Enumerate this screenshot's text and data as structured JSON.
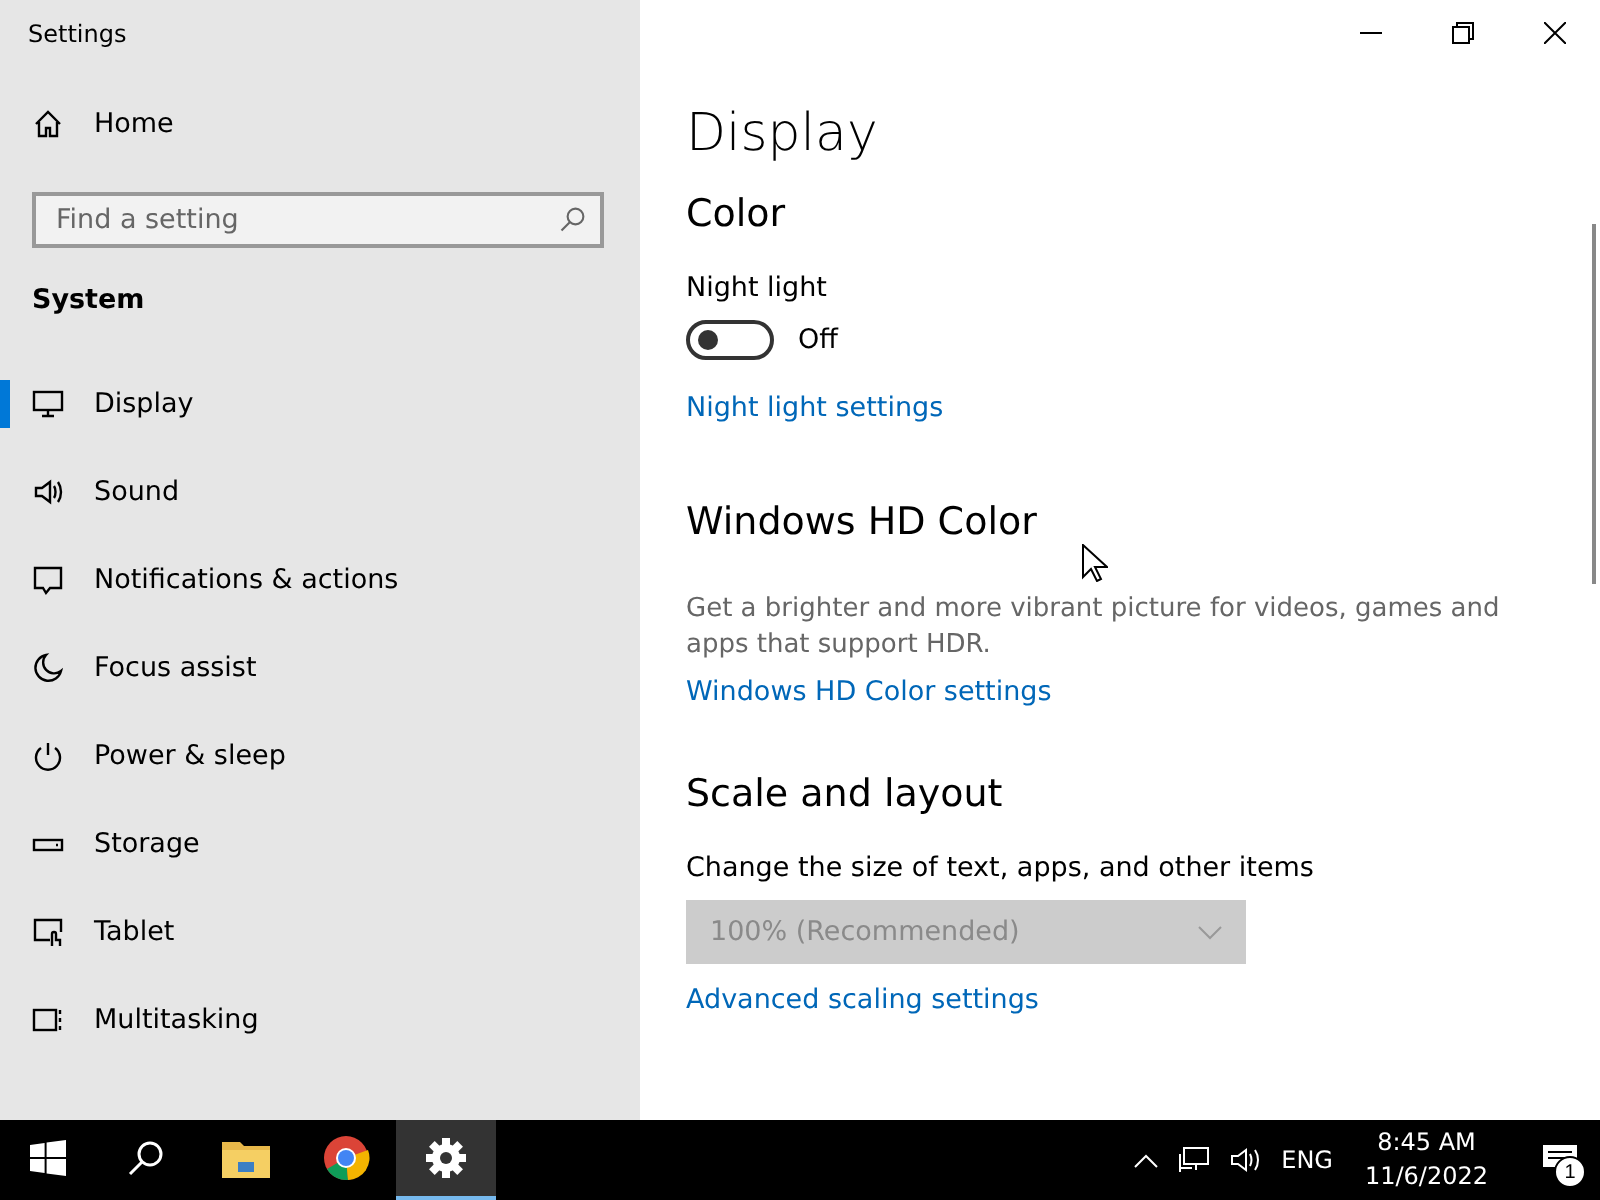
{
  "window": {
    "title": "Settings"
  },
  "sidebar": {
    "home": {
      "label": "Home"
    },
    "search": {
      "placeholder": "Find a setting"
    },
    "section": "System",
    "items": [
      {
        "label": "Display",
        "selected": true
      },
      {
        "label": "Sound",
        "selected": false
      },
      {
        "label": "Notifications & actions",
        "selected": false
      },
      {
        "label": "Focus assist",
        "selected": false
      },
      {
        "label": "Power & sleep",
        "selected": false
      },
      {
        "label": "Storage",
        "selected": false
      },
      {
        "label": "Tablet",
        "selected": false
      },
      {
        "label": "Multitasking",
        "selected": false
      }
    ]
  },
  "page": {
    "title": "Display",
    "color": {
      "heading": "Color",
      "night_light": {
        "label": "Night light",
        "on": false,
        "state_text": "Off"
      },
      "link": "Night light settings"
    },
    "hd_color": {
      "heading": "Windows HD Color",
      "description": "Get a brighter and more vibrant picture for videos, games and apps that support HDR.",
      "link": "Windows HD Color settings"
    },
    "scale": {
      "heading": "Scale and layout",
      "label": "Change the size of text, apps, and other items",
      "dropdown": {
        "value": "100% (Recommended)",
        "disabled": true
      },
      "link": "Advanced scaling settings"
    }
  },
  "taskbar": {
    "apps": [
      {
        "selected": false
      },
      {
        "selected": false
      },
      {
        "selected": false
      },
      {
        "selected": true
      }
    ],
    "language": "ENG",
    "time": "8:45 AM",
    "date": "11/6/2022",
    "notification_count": "1"
  }
}
